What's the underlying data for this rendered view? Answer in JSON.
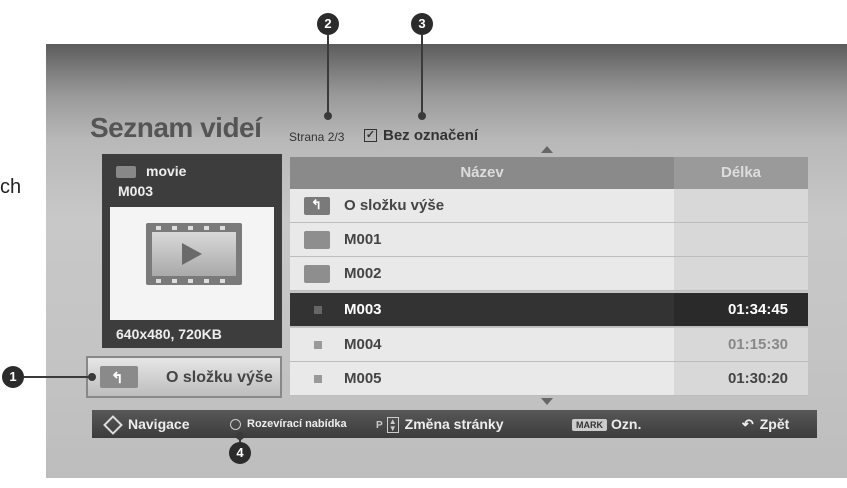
{
  "side_text": "ch",
  "callouts": [
    "1",
    "2",
    "3",
    "4"
  ],
  "header": {
    "title": "Seznam videí",
    "page_indicator": "Strana 2/3",
    "checkbox_label": "Bez označení"
  },
  "preview": {
    "folder": "movie",
    "file": "M003",
    "resolution": "640x480, 720KB"
  },
  "up_button": {
    "label": "O složku výše"
  },
  "table": {
    "columns": [
      "Název",
      "Délka"
    ],
    "rows": [
      {
        "name": "O složku výše",
        "length": "",
        "type": "up"
      },
      {
        "name": "M001",
        "length": "",
        "type": "folder"
      },
      {
        "name": "M002",
        "length": "",
        "type": "folder"
      },
      {
        "name": "M003",
        "length": "01:34:45",
        "type": "file",
        "selected": true
      },
      {
        "name": "M004",
        "length": "01:15:30",
        "type": "file"
      },
      {
        "name": "M005",
        "length": "01:30:20",
        "type": "file"
      }
    ]
  },
  "bottom_bar": {
    "navigate": "Navigace",
    "popup_menu": "Rozevírací nabídka",
    "page_change_key": "P",
    "page_change": "Změna stránky",
    "mark_key": "MARK",
    "mark": "Ozn.",
    "back": "Zpět"
  }
}
